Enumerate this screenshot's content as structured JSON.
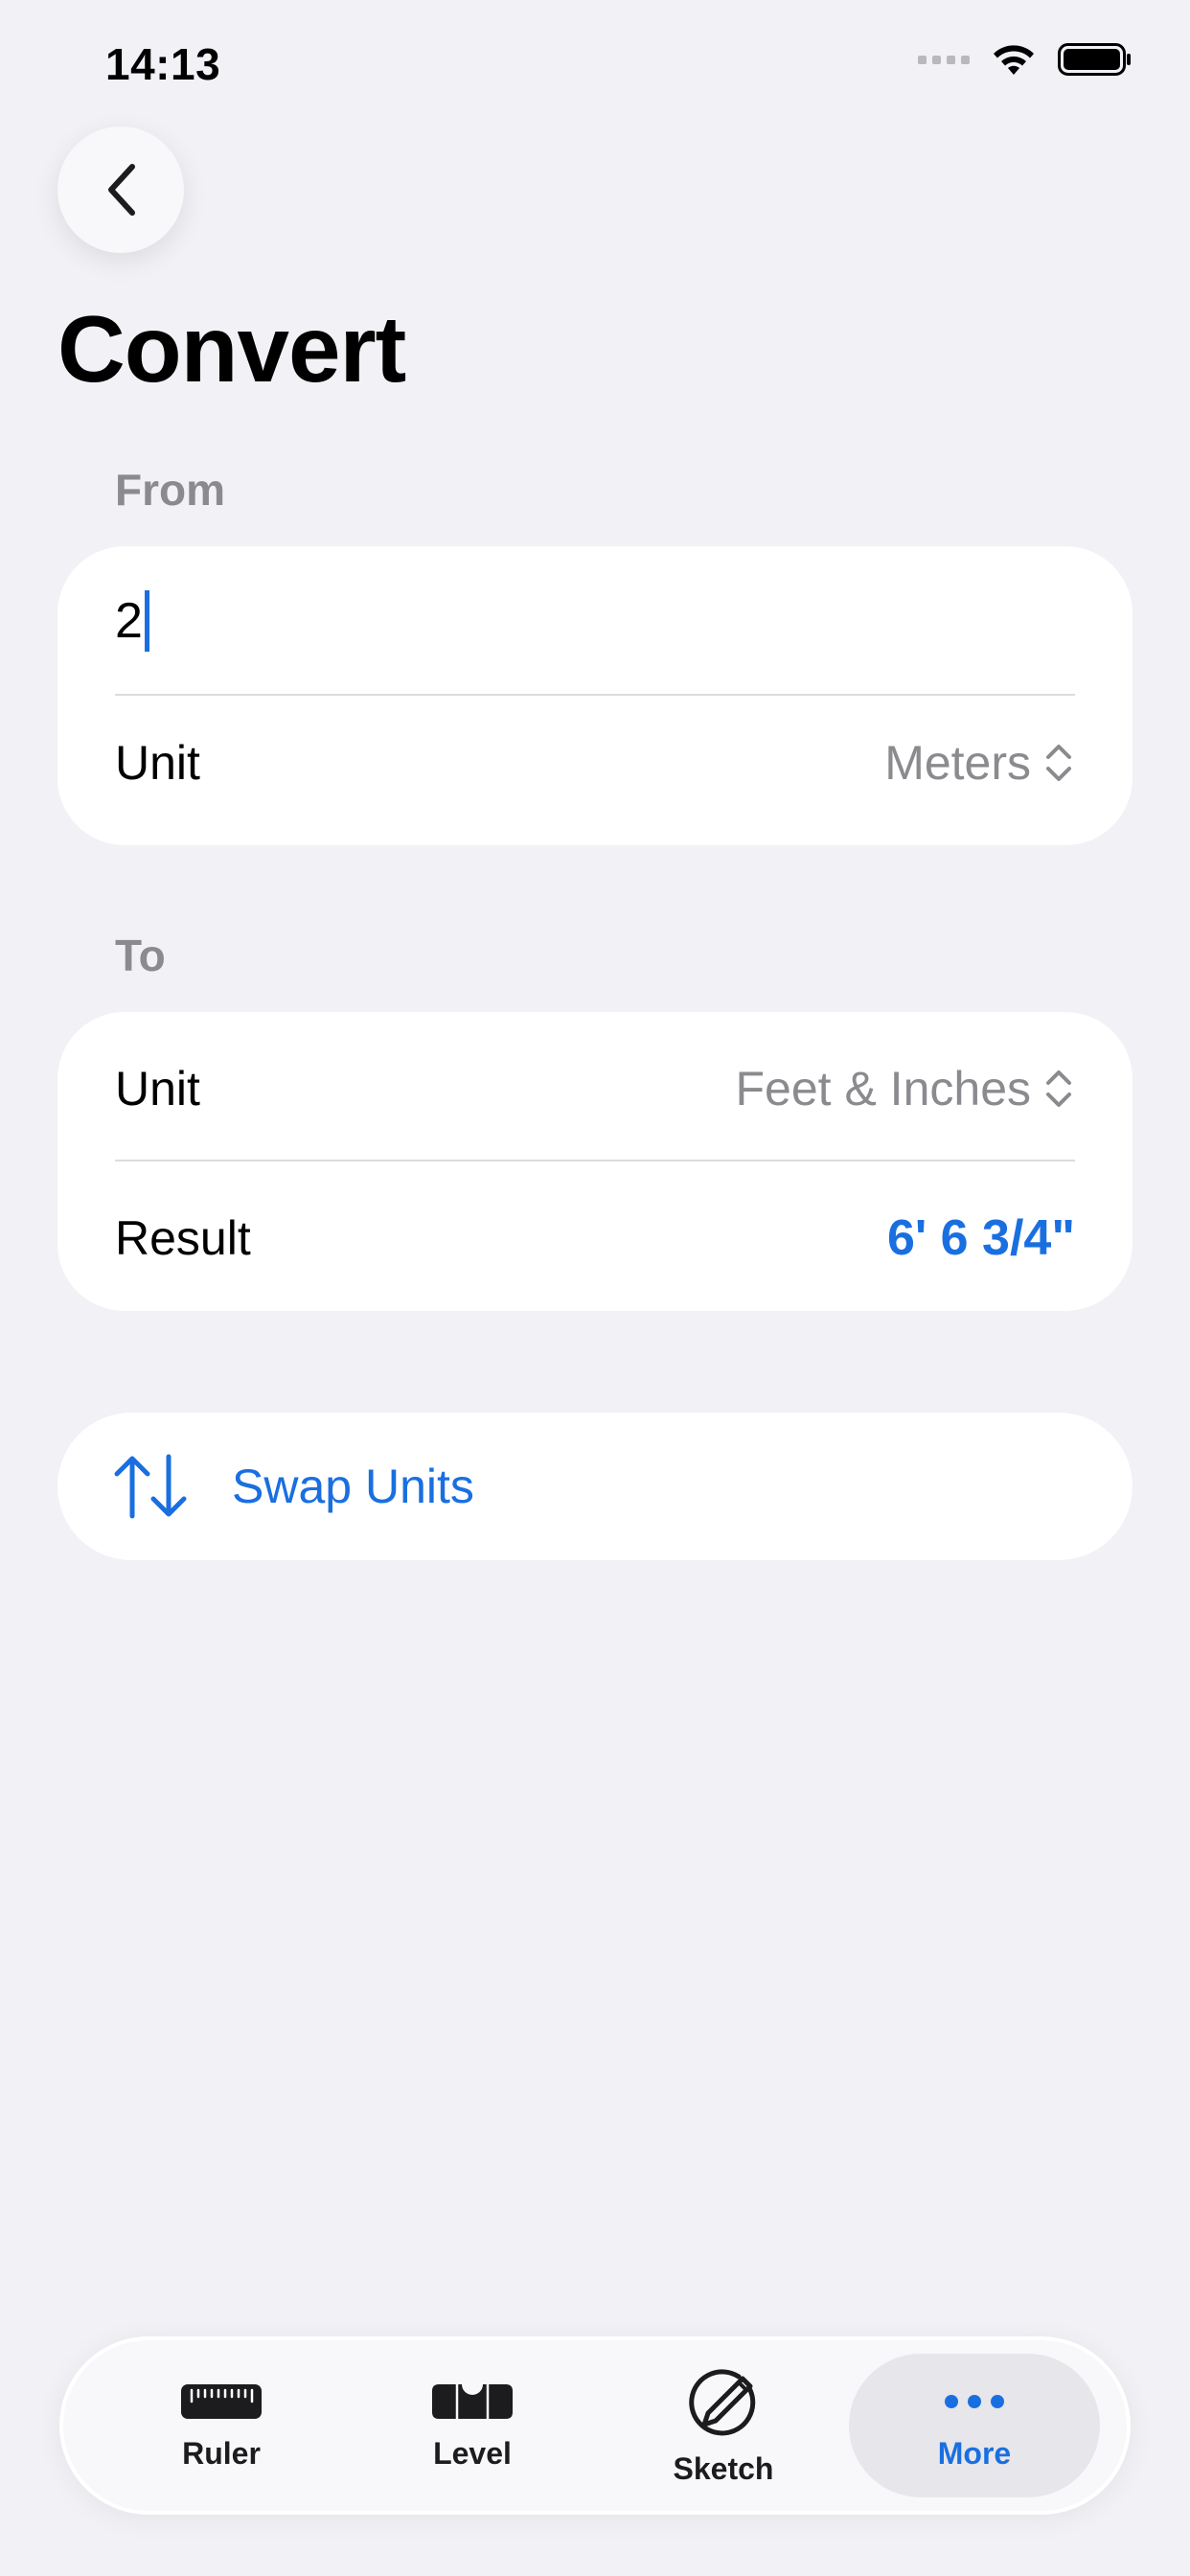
{
  "status_bar": {
    "time": "14:13"
  },
  "header": {
    "title": "Convert"
  },
  "from": {
    "label": "From",
    "value": "2",
    "unit_label": "Unit",
    "unit_value": "Meters"
  },
  "to": {
    "label": "To",
    "unit_label": "Unit",
    "unit_value": "Feet & Inches",
    "result_label": "Result",
    "result_value": "6' 6 3/4\""
  },
  "swap": {
    "label": "Swap Units"
  },
  "tabs": [
    {
      "label": "Ruler",
      "icon": "ruler-icon",
      "active": false
    },
    {
      "label": "Level",
      "icon": "level-icon",
      "active": false
    },
    {
      "label": "Sketch",
      "icon": "sketch-icon",
      "active": false
    },
    {
      "label": "More",
      "icon": "more-icon",
      "active": true
    }
  ],
  "colors": {
    "accent": "#1a6fe0",
    "background": "#f1f1f6",
    "secondary_text": "#8a8a8f"
  }
}
